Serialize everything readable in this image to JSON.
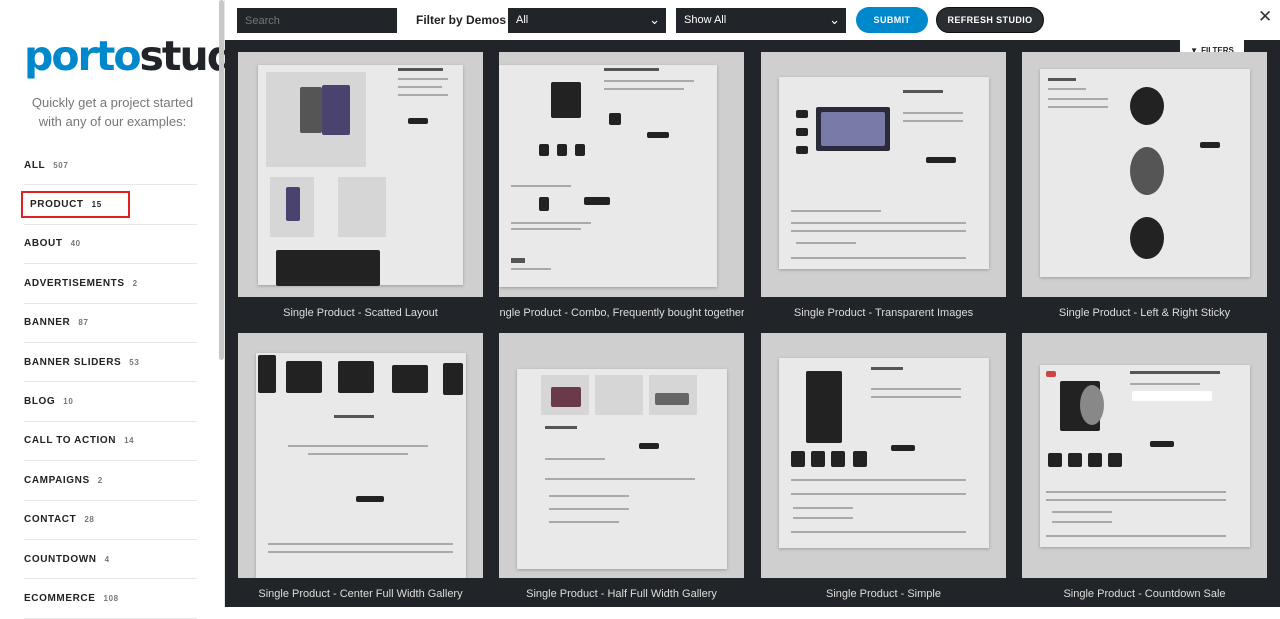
{
  "sidebar": {
    "logo": {
      "part1": "porto",
      "part2": "studio"
    },
    "tagline": "Quickly get a project started with any of our examples:",
    "categories": [
      {
        "label": "ALL",
        "count": "507"
      },
      {
        "label": "PRODUCT",
        "count": "15",
        "active": true
      },
      {
        "label": "ABOUT",
        "count": "40"
      },
      {
        "label": "ADVERTISEMENTS",
        "count": "2"
      },
      {
        "label": "BANNER",
        "count": "87"
      },
      {
        "label": "BANNER SLIDERS",
        "count": "53"
      },
      {
        "label": "BLOG",
        "count": "10"
      },
      {
        "label": "CALL TO ACTION",
        "count": "14"
      },
      {
        "label": "CAMPAIGNS",
        "count": "2"
      },
      {
        "label": "CONTACT",
        "count": "28"
      },
      {
        "label": "COUNTDOWN",
        "count": "4"
      },
      {
        "label": "ECOMMERCE",
        "count": "108"
      }
    ]
  },
  "toolbar": {
    "search_placeholder": "Search",
    "filter_label": "Filter by Demos",
    "demo_select": "All",
    "show_select": "Show All",
    "submit_label": "SUBMIT",
    "refresh_label": "REFRESH STUDIO",
    "close_glyph": "✕"
  },
  "filters_button": "FILTERS",
  "cards": [
    {
      "title": "Single Product - Scatted Layout"
    },
    {
      "title": "Single Product - Combo, Frequently bought together..."
    },
    {
      "title": "Single Product - Transparent Images"
    },
    {
      "title": "Single Product - Left & Right Sticky"
    },
    {
      "title": "Single Product - Center Full Width Gallery"
    },
    {
      "title": "Single Product - Half Full Width Gallery"
    },
    {
      "title": "Single Product - Simple"
    },
    {
      "title": "Single Product - Countdown Sale"
    }
  ],
  "colors": {
    "accent": "#0088cc",
    "dark": "#212529",
    "highlight": "#e02020"
  }
}
